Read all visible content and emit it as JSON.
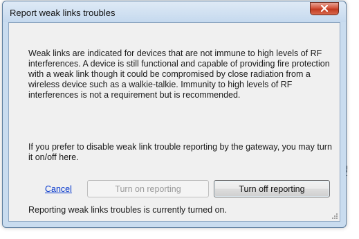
{
  "window": {
    "title": "Report weak links troubles"
  },
  "content": {
    "paragraph1": "Weak links are indicated for devices that are not immune to high levels of RF interferences. A device is still functional and capable of providing fire protection with a weak link though it could be compromised by close radiation from a wireless device such as a walkie-talkie. Immunity to high levels of RF interferences is not a requirement but is recommended.",
    "paragraph2": "If you prefer to disable weak link trouble reporting by the gateway, you may turn it on/off here."
  },
  "actions": {
    "cancel_label": "Cancel",
    "turn_on_label": "Turn on reporting",
    "turn_off_label": "Turn off reporting"
  },
  "status": {
    "text": "Reporting weak links troubles is currently turned on."
  },
  "side_caption": "ucdpg_twsu",
  "icons": {
    "close": "close-icon",
    "grip": "resize-grip-icon"
  }
}
